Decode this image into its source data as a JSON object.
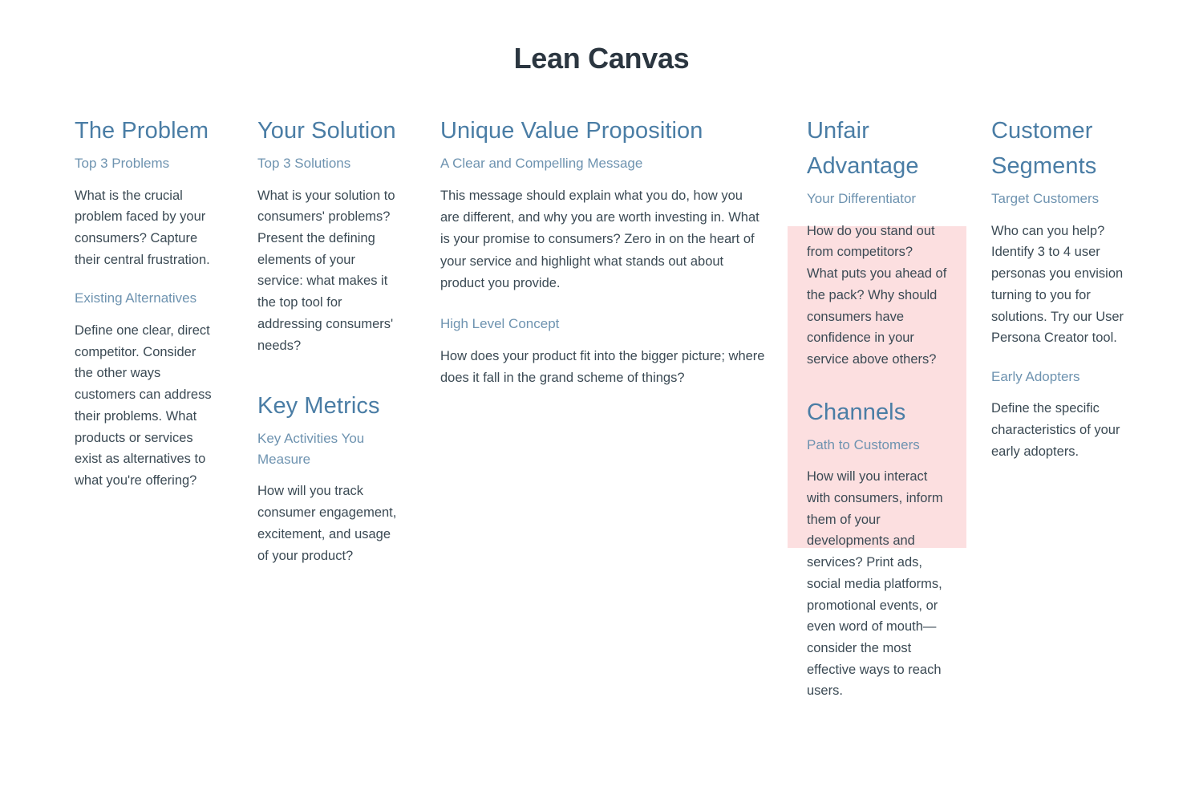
{
  "page": {
    "title": "Lean Canvas",
    "colors": {
      "heading": "#4a7da5",
      "subheading": "#6e93b0",
      "body": "#3b4a54",
      "title": "#2b3640",
      "highlight": "#fcdfe0",
      "background": "#ffffff"
    }
  },
  "blocks": {
    "problem": {
      "heading": "The Problem",
      "subheading": "Top 3 Problems",
      "body": "What is the crucial problem faced by your consumers? Capture their central frustration.",
      "sub2_heading": "Existing Alternatives",
      "sub2_body": "Define one clear, direct competitor. Consider the other ways customers can address their problems. What products or services exist as alternatives to what you're offering?"
    },
    "solution": {
      "heading": "Your Solution",
      "subheading": "Top 3 Solutions",
      "body": "What is your solution to consumers' problems? Present the defining elements of your service: what makes it the top tool for addressing consumers' needs?",
      "sub2_heading": "Key Metrics",
      "sub2_subheading": "Key Activities You Measure",
      "sub2_body": "How will you track consumer engagement, excitement, and usage of your product?"
    },
    "uvp": {
      "heading": "Unique Value Proposition",
      "subheading": "A Clear and Compelling Message",
      "body": "This message should explain what you do, how you are different, and why you are worth investing in. What is your promise to consumers? Zero in on the heart of your service and highlight what stands out about product you provide.",
      "sub2_heading": "High Level Concept",
      "sub2_body": "How does your product fit into the bigger picture; where does it fall in the grand scheme of things?"
    },
    "unfair": {
      "heading": "Unfair Advantage",
      "subheading": "Your Differentiator",
      "body": "How do you stand out from competitors? What puts you ahead of the pack? Why should consumers have confidence in your service above others?",
      "sub2_heading": "Channels",
      "sub2_subheading": "Path to Customers",
      "sub2_body": "How will you interact with consumers, inform them of your developments and services? Print ads, social media platforms, promotional events, or even word of mouth—consider the most effective ways to reach users."
    },
    "segments": {
      "heading": "Customer Segments",
      "subheading": "Target Customers",
      "body": "Who can you help? Identify 3 to 4 user personas you envision turning to you for solutions. Try our User Persona Creator tool.",
      "sub2_heading": "Early Adopters",
      "sub2_body": "Define the specific characteristics of your early adopters."
    }
  }
}
